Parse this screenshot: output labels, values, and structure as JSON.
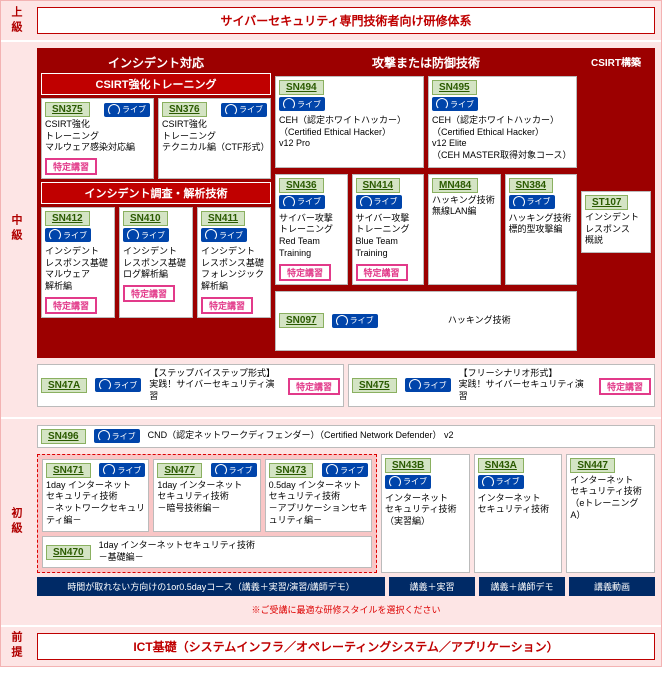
{
  "levels": {
    "advanced": "上級",
    "intermediate": "中級",
    "beginner": "初級",
    "prereq": "前提"
  },
  "top_banner": "サイバーセキュリティ専門技術者向け研修体系",
  "sections": {
    "incident": "インシデント対応",
    "csirt_training": "CSIRT強化トレーニング",
    "analysis": "インシデント調査・解析技術",
    "attack": "攻撃または防御技術",
    "csirt_build": "CSIRT構築"
  },
  "live": "ライブ",
  "tokutei": "特定講習",
  "cards": {
    "sn375": {
      "code": "SN375",
      "txt": "CSIRT強化\nトレーニング\nマルウェア感染対応編"
    },
    "sn376": {
      "code": "SN376",
      "txt": "CSIRT強化\nトレーニング\nテクニカル編（CTF形式）"
    },
    "sn412": {
      "code": "SN412",
      "txt": "インシデント\nレスポンス基礎\nマルウェア\n解析編"
    },
    "sn410": {
      "code": "SN410",
      "txt": "インシデント\nレスポンス基礎\nログ解析編"
    },
    "sn411": {
      "code": "SN411",
      "txt": "インシデント\nレスポンス基礎\nフォレンジック\n解析編"
    },
    "sn494": {
      "code": "SN494",
      "txt": "CEH（認定ホワイトハッカー）\n（Certified Ethical Hacker）\nv12 Pro"
    },
    "sn495": {
      "code": "SN495",
      "txt": "CEH（認定ホワイトハッカー）\n（Certified Ethical Hacker）\nv12 Elite\n（CEH MASTER取得対象コース）"
    },
    "sn436": {
      "code": "SN436",
      "txt": "サイバー攻撃\nトレーニング\nRed Team\nTraining"
    },
    "sn414": {
      "code": "SN414",
      "txt": "サイバー攻撃\nトレーニング\nBlue Team\nTraining"
    },
    "mn484": {
      "code": "MN484",
      "txt": "ハッキング技術\n無線LAN編"
    },
    "sn384": {
      "code": "SN384",
      "txt": "ハッキング技術\n標的型攻撃編"
    },
    "sn097": {
      "code": "SN097",
      "txt": "ハッキング技術"
    },
    "st107": {
      "code": "ST107",
      "txt": "インシデント\nレスポンス\n概説"
    },
    "sn47a": {
      "code": "SN47A",
      "txt": "【ステップバイステップ形式】\n実践！サイバーセキュリティ演習"
    },
    "sn475": {
      "code": "SN475",
      "txt": "【フリーシナリオ形式】\n実践！サイバーセキュリティ演習"
    },
    "sn496": {
      "code": "SN496",
      "txt": "CND（認定ネットワークディフェンダー）（Certified Network Defender） v2"
    },
    "sn471": {
      "code": "SN471",
      "txt": "1day インターネット\nセキュリティ技術\n－ネットワークセキュリティ編－"
    },
    "sn477": {
      "code": "SN477",
      "txt": "1day インターネット\nセキュリティ技術\n－暗号技術編－"
    },
    "sn473": {
      "code": "SN473",
      "txt": "0.5day インターネット\nセキュリティ技術\n－アプリケーションセキュリティ編－"
    },
    "sn470": {
      "code": "SN470",
      "txt": "1day インターネットセキュリティ技術\n－基礎編－"
    },
    "sn43b": {
      "code": "SN43B",
      "txt": "インターネット\nセキュリティ技術\n（実習編）"
    },
    "sn43a": {
      "code": "SN43A",
      "txt": "インターネット\nセキュリティ技術"
    },
    "sn447": {
      "code": "SN447",
      "txt": "インターネット\nセキュリティ技術\n（eトレーニング A）"
    }
  },
  "beginner_bar": "時間が取れない方向けの1or0.5dayコース（講義＋実習/演習/講師デモ）",
  "mini": {
    "b1": "講義＋実習",
    "b2": "講義＋講師デモ",
    "b3": "講義動画"
  },
  "note": "※ご受講に最適な研修スタイルを選択ください",
  "prereq_banner": "ICT基礎（システムインフラ／オペレーティングシステム／アプリケーション）"
}
